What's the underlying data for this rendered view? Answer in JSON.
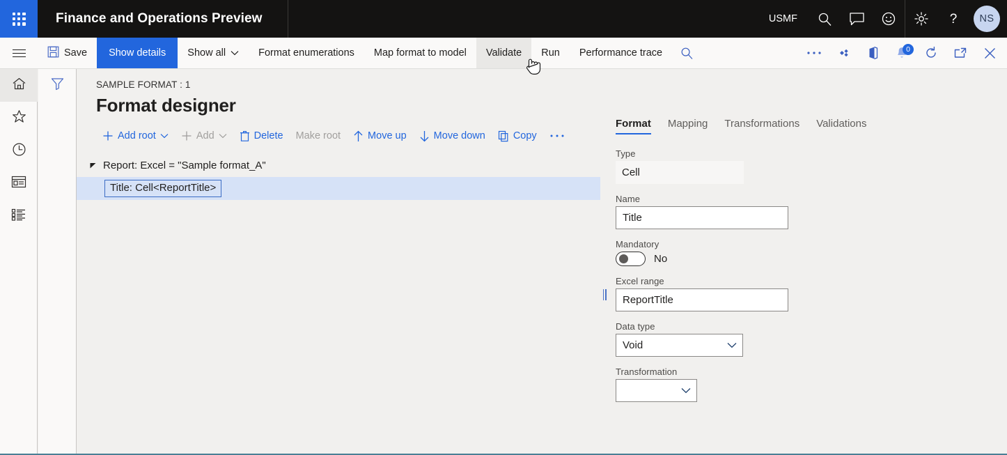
{
  "topbar": {
    "app_launcher_icon": "waffle-grid-icon",
    "title": "Finance and Operations Preview",
    "company": "USMF",
    "icons": [
      {
        "name": "search-icon",
        "label": "Search"
      },
      {
        "name": "message-icon",
        "label": "Messages"
      },
      {
        "name": "feedback-smiley-icon",
        "label": "Feedback"
      },
      {
        "name": "gear-icon",
        "label": "Settings"
      },
      {
        "name": "help-question-icon",
        "label": "Help"
      }
    ],
    "avatar_initials": "NS"
  },
  "commandbar": {
    "hamburger_icon": "hamburger-menu-icon",
    "buttons": [
      {
        "label": "Save",
        "icon": "save-disk-icon",
        "style": "default",
        "state": "normal"
      },
      {
        "label": "Show details",
        "icon": "",
        "style": "primary",
        "state": "normal"
      },
      {
        "label": "Show all",
        "icon": "",
        "style": "default",
        "state": "normal",
        "chevron": "⌄"
      },
      {
        "label": "Format enumerations",
        "icon": "",
        "style": "default",
        "state": "normal"
      },
      {
        "label": "Map format to model",
        "icon": "",
        "style": "default",
        "state": "normal"
      },
      {
        "label": "Validate",
        "icon": "",
        "style": "default",
        "state": "hovered"
      },
      {
        "label": "Run",
        "icon": "",
        "style": "default",
        "state": "normal"
      },
      {
        "label": "Performance trace",
        "icon": "",
        "style": "default",
        "state": "normal"
      }
    ],
    "right_icons": [
      {
        "name": "search-icon"
      },
      {
        "name": "overflow-ellipsis-icon"
      },
      {
        "name": "attach-diamond-icon"
      },
      {
        "name": "open-in-office-icon"
      },
      {
        "name": "notifications-bell-icon",
        "badge": "0"
      },
      {
        "name": "refresh-icon"
      },
      {
        "name": "popout-window-icon"
      },
      {
        "name": "close-icon"
      }
    ]
  },
  "navrail": {
    "items": [
      {
        "name": "sidebar-item-home",
        "icon": "home-icon",
        "active": true
      },
      {
        "name": "sidebar-item-favorites",
        "icon": "star-icon",
        "active": false
      },
      {
        "name": "sidebar-item-recent",
        "icon": "clock-icon",
        "active": false
      },
      {
        "name": "sidebar-item-workspaces",
        "icon": "workspace-icon",
        "active": false
      },
      {
        "name": "sidebar-item-modules",
        "icon": "list-icon",
        "active": false
      }
    ]
  },
  "filtercol": {
    "filter_icon": "filter-funnel-icon"
  },
  "main": {
    "breadcrumb": "SAMPLE FORMAT : 1",
    "page_title": "Format designer",
    "actions": [
      {
        "label": "Add root",
        "icon": "plus-icon",
        "chevron": "⌄",
        "disabled": false
      },
      {
        "label": "Add",
        "icon": "plus-icon",
        "chevron": "⌄",
        "disabled": true
      },
      {
        "label": "Delete",
        "icon": "trash-icon",
        "chevron": "",
        "disabled": false
      },
      {
        "label": "Make root",
        "icon": "",
        "chevron": "",
        "disabled": true
      },
      {
        "label": "Move up",
        "icon": "arrow-up-icon",
        "chevron": "",
        "disabled": false
      },
      {
        "label": "Move down",
        "icon": "arrow-down-icon",
        "chevron": "",
        "disabled": false
      },
      {
        "label": "Copy",
        "icon": "copy-icon",
        "chevron": "",
        "disabled": false
      },
      {
        "label": "",
        "icon": "overflow-ellipsis-icon",
        "chevron": "",
        "disabled": false
      }
    ],
    "tree": {
      "root": {
        "label": "Report: Excel = \"Sample format_A\"",
        "expanded": true,
        "twisty_icon": "triangle-expanded-icon"
      },
      "children": [
        {
          "label": "Title: Cell<ReportTitle>",
          "selected": true
        }
      ]
    }
  },
  "props": {
    "tabs": [
      {
        "label": "Format",
        "active": true
      },
      {
        "label": "Mapping",
        "active": false
      },
      {
        "label": "Transformations",
        "active": false
      },
      {
        "label": "Validations",
        "active": false
      }
    ],
    "fields": {
      "type": {
        "label": "Type",
        "value": "Cell"
      },
      "name": {
        "label": "Name",
        "value": "Title",
        "placeholder": ""
      },
      "mandatory": {
        "label": "Mandatory",
        "value": "No",
        "on": false
      },
      "excel_range": {
        "label": "Excel range",
        "value": "ReportTitle",
        "placeholder": ""
      },
      "data_type": {
        "label": "Data type",
        "value": "Void",
        "options": [
          "Void"
        ],
        "chevron_icon": "chevron-down-icon"
      },
      "transformation": {
        "label": "Transformation",
        "value": "",
        "options": [
          ""
        ],
        "chevron_icon": "chevron-down-icon"
      }
    }
  },
  "colors": {
    "brand_blue": "#2266DD",
    "topbar_black": "#141312",
    "page_bg": "#f1f0ee",
    "chrome_bg": "#faf9f8",
    "selected_row": "#d6e2f7",
    "selection_border": "#3b6cc4",
    "bottom_rule": "#4a7f95"
  }
}
